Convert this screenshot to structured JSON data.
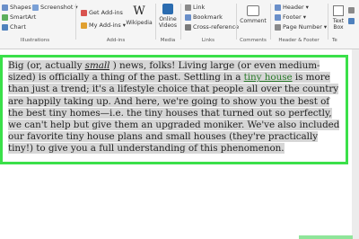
{
  "ribbon": {
    "illustrations": {
      "shapes": "Shapes",
      "screenshot": "Screenshot",
      "smartart": "SmartArt",
      "chart": "Chart",
      "label": "Illustrations"
    },
    "addins": {
      "get_addins": "Get Add-ins",
      "my_addins": "My Add-ins",
      "wikipedia": "Wikipedia",
      "label": "Add-ins"
    },
    "media": {
      "online_videos": "Online Videos",
      "label": "Media"
    },
    "links": {
      "link": "Link",
      "bookmark": "Bookmark",
      "cross_reference": "Cross-reference",
      "label": "Links"
    },
    "comments": {
      "comment": "Comment",
      "label": "Comments"
    },
    "header_footer": {
      "header": "Header",
      "footer": "Footer",
      "page_number": "Page Number",
      "label": "Header & Footer"
    },
    "text": {
      "text_box": "Text Box",
      "label": "Te"
    }
  },
  "document": {
    "p1": "Big (or, actually ",
    "p2": "small",
    "p3": " ) news, folks! Living large (or even medium-sized) is officially a thing of the past. Settling in a ",
    "p4": "tiny house",
    "p5": " is more than just a trend; it's a lifestyle choice that people all over the country are happily taking up. And here, we're going to show you the best of the best tiny homes—i.e. the tiny houses that turned out so perfectly, we can't help but give them an upgraded moniker. We've also included our favorite tiny house plans and small houses (they're practically tiny!) to give you a full understanding of this phenomenon."
  },
  "colors": {
    "highlight_border": "#3be04a",
    "selection": "#d6d6d6",
    "link": "#2a7a2a"
  }
}
